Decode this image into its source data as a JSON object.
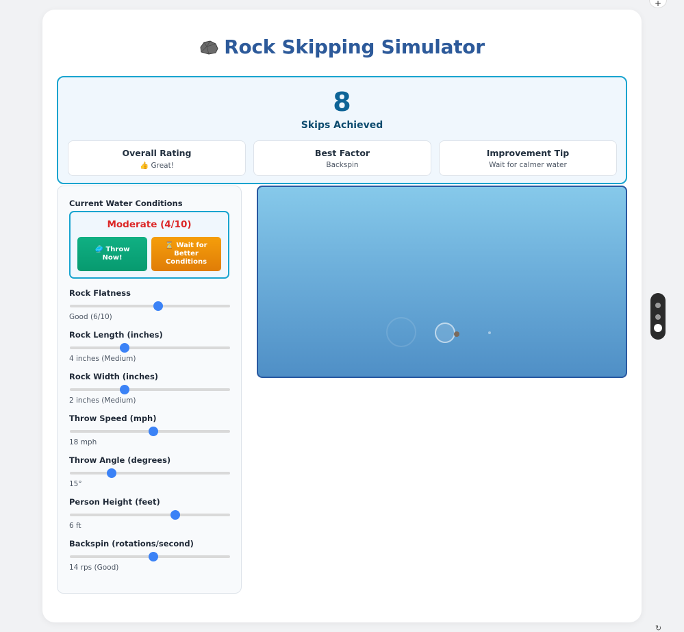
{
  "header": {
    "title": "Rock Skipping Simulator",
    "icon": "rock-icon"
  },
  "results": {
    "skips": "8",
    "skips_label": "Skips Achieved",
    "stats": [
      {
        "title": "Overall Rating",
        "value": "👍 Great!"
      },
      {
        "title": "Best Factor",
        "value": "Backspin"
      },
      {
        "title": "Improvement Tip",
        "value": "Wait for calmer water"
      }
    ]
  },
  "conditions": {
    "title": "Current Water Conditions",
    "status": "Moderate (4/10)",
    "status_color": "#dc2626",
    "throw_button": "🥏 Throw Now!",
    "wait_button": "⏳ Wait for Better Conditions"
  },
  "sliders": [
    {
      "label": "Rock Flatness",
      "value_text": "Good (6/10)",
      "fraction": 0.55
    },
    {
      "label": "Rock Length (inches)",
      "value_text": "4 inches (Medium)",
      "fraction": 0.34
    },
    {
      "label": "Rock Width (inches)",
      "value_text": "2 inches (Medium)",
      "fraction": 0.34
    },
    {
      "label": "Throw Speed (mph)",
      "value_text": "18 mph",
      "fraction": 0.52
    },
    {
      "label": "Throw Angle (degrees)",
      "value_text": "15°",
      "fraction": 0.26
    },
    {
      "label": "Person Height (feet)",
      "value_text": "6 ft",
      "fraction": 0.66
    },
    {
      "label": "Backspin (rotations/second)",
      "value_text": "14 rps (Good)",
      "fraction": 0.52
    }
  ],
  "colors": {
    "accent": "#3b82f6",
    "title": "#2d5a9a",
    "panel_border": "#19a4cf",
    "throw": "#10b083",
    "wait": "#f59e0b"
  }
}
